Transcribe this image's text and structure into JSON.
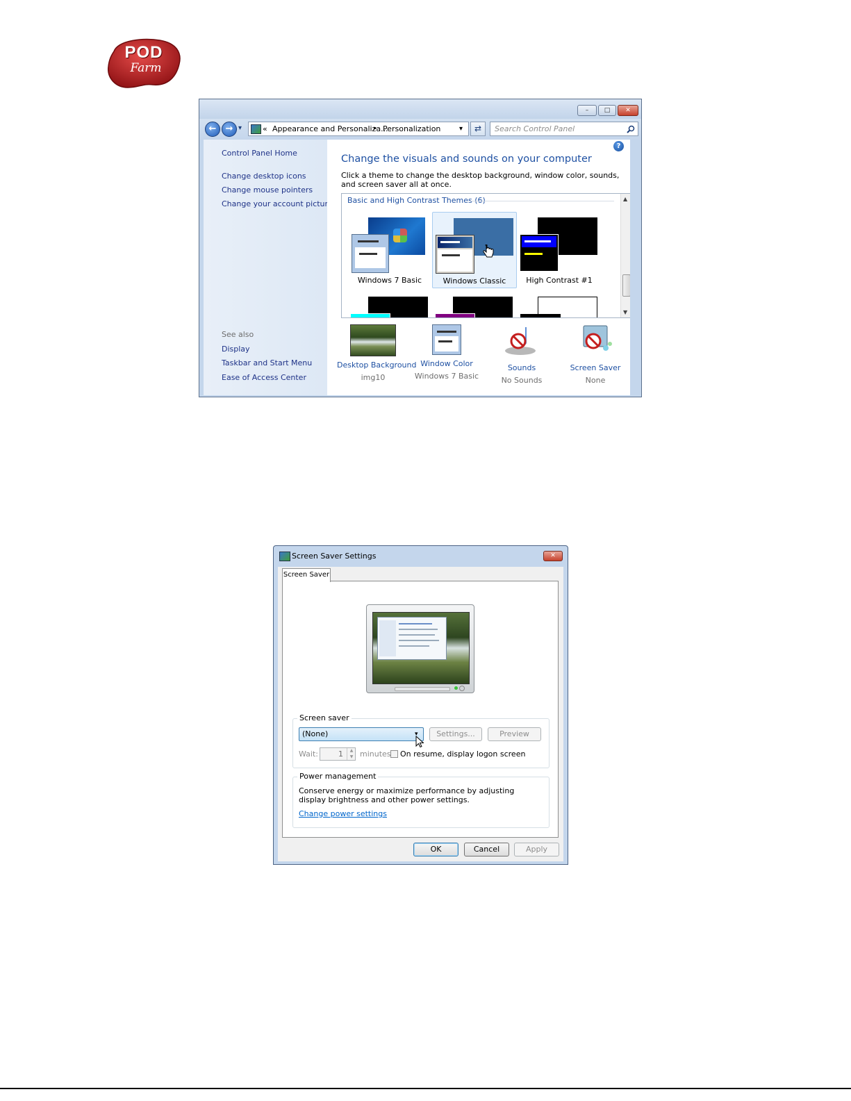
{
  "logo": {
    "line1": "POD",
    "line2": "Farm"
  },
  "control_panel": {
    "window_buttons": {
      "minimize": "–",
      "maximize": "□",
      "close": "✕"
    },
    "nav": {
      "back": "←",
      "forward": "→",
      "recent": "▾"
    },
    "address": {
      "separator": "«",
      "crumb1": "Appearance and Personaliza...",
      "arrow": "▸",
      "crumb2": "Personalization",
      "dropdown": "▾",
      "refresh": "⇄"
    },
    "search": {
      "placeholder": "Search Control Panel"
    },
    "help": "?",
    "left_nav": {
      "home": "Control Panel Home",
      "links": [
        "Change desktop icons",
        "Change mouse pointers",
        "Change your account picture"
      ],
      "see_also_label": "See also",
      "see_also": [
        "Display",
        "Taskbar and Start Menu",
        "Ease of Access Center"
      ]
    },
    "heading": "Change the visuals and sounds on your computer",
    "description": "Click a theme to change the desktop background, window color, sounds, and screen saver all at once.",
    "themes_header": "Basic and High Contrast Themes (6)",
    "themes": [
      {
        "name": "Windows 7 Basic",
        "selected": false
      },
      {
        "name": "Windows Classic",
        "selected": true
      },
      {
        "name": "High Contrast #1",
        "selected": false
      }
    ],
    "bottom": [
      {
        "link": "Desktop Background",
        "value": "img10"
      },
      {
        "link": "Window Color",
        "value": "Windows 7 Basic"
      },
      {
        "link": "Sounds",
        "value": "No Sounds"
      },
      {
        "link": "Screen Saver",
        "value": "None"
      }
    ]
  },
  "screen_saver_dialog": {
    "title": "Screen Saver Settings",
    "close": "✕",
    "tab": "Screen Saver",
    "screen_saver_group": "Screen saver",
    "selected_saver": "(None)",
    "settings_button": "Settings...",
    "preview_button": "Preview",
    "wait_label": "Wait:",
    "wait_value": "1",
    "minutes_label": "minutes",
    "resume_label": "On resume, display logon screen",
    "power_group": "Power management",
    "power_text": "Conserve energy or maximize performance by adjusting display brightness and other power settings.",
    "power_link": "Change power settings",
    "ok": "OK",
    "cancel": "Cancel",
    "apply": "Apply"
  }
}
